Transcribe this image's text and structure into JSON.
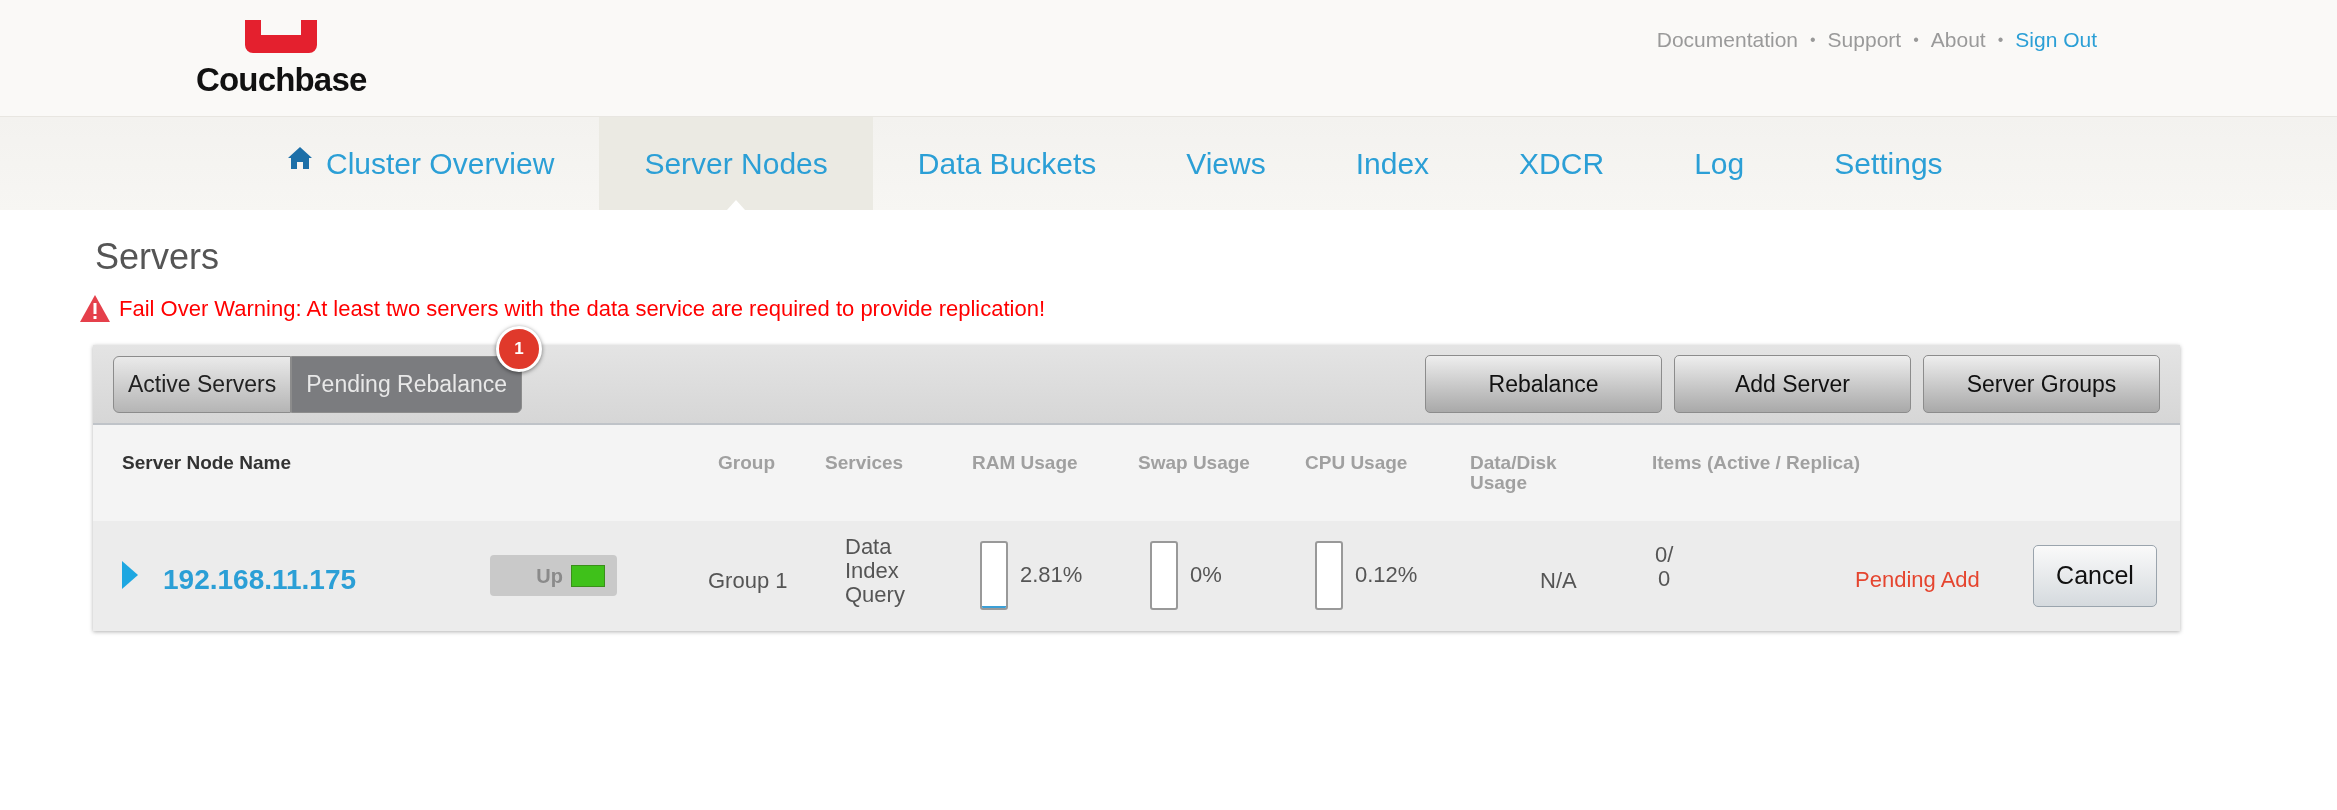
{
  "logo": {
    "text": "Couchbase"
  },
  "top_links": [
    {
      "label": "Documentation",
      "kind": "plain"
    },
    {
      "label": "•",
      "kind": "separator"
    },
    {
      "label": "Support",
      "kind": "plain"
    },
    {
      "label": "•",
      "kind": "separator"
    },
    {
      "label": "About",
      "kind": "plain"
    },
    {
      "label": "•",
      "kind": "separator"
    },
    {
      "label": "Sign Out",
      "kind": "accent"
    }
  ],
  "nav": [
    {
      "label": "Cluster Overview",
      "selected": false,
      "kind": "home"
    },
    {
      "label": "Server Nodes",
      "selected": true
    },
    {
      "label": "Data Buckets",
      "selected": false
    },
    {
      "label": "Views",
      "selected": false
    },
    {
      "label": "Index",
      "selected": false
    },
    {
      "label": "XDCR",
      "selected": false
    },
    {
      "label": "Log",
      "selected": false
    },
    {
      "label": "Settings",
      "selected": false
    }
  ],
  "page_title": "Servers",
  "warning": "Fail Over Warning: At least two servers with the data service are required to provide replication!",
  "tabs": [
    {
      "label": "Active Servers",
      "selected": false
    },
    {
      "label": "Pending Rebalance",
      "selected": true,
      "badge": "1"
    }
  ],
  "actions": [
    "Rebalance",
    "Add Server",
    "Server Groups"
  ],
  "table": {
    "columns": [
      "Server Node Name",
      "Group",
      "Services",
      "RAM Usage",
      "Swap Usage",
      "CPU Usage",
      "Data/Disk Usage",
      "Items (Active / Replica)"
    ],
    "rows": [
      {
        "expanded": false,
        "name": "192.168.11.175",
        "status": "Up",
        "status_ok": true,
        "group": "Group 1",
        "services": [
          "Data",
          "Index",
          "Query"
        ],
        "ram": {
          "level": 0.028,
          "reading": "2.81%"
        },
        "swap": {
          "level": 0,
          "reading": "0%"
        },
        "cpu": {
          "level": 0.0012,
          "reading": "0.12%"
        },
        "disk": "N/A",
        "items": [
          "0/",
          "0"
        ],
        "state": "Pending Add",
        "action": "Cancel"
      }
    ]
  }
}
